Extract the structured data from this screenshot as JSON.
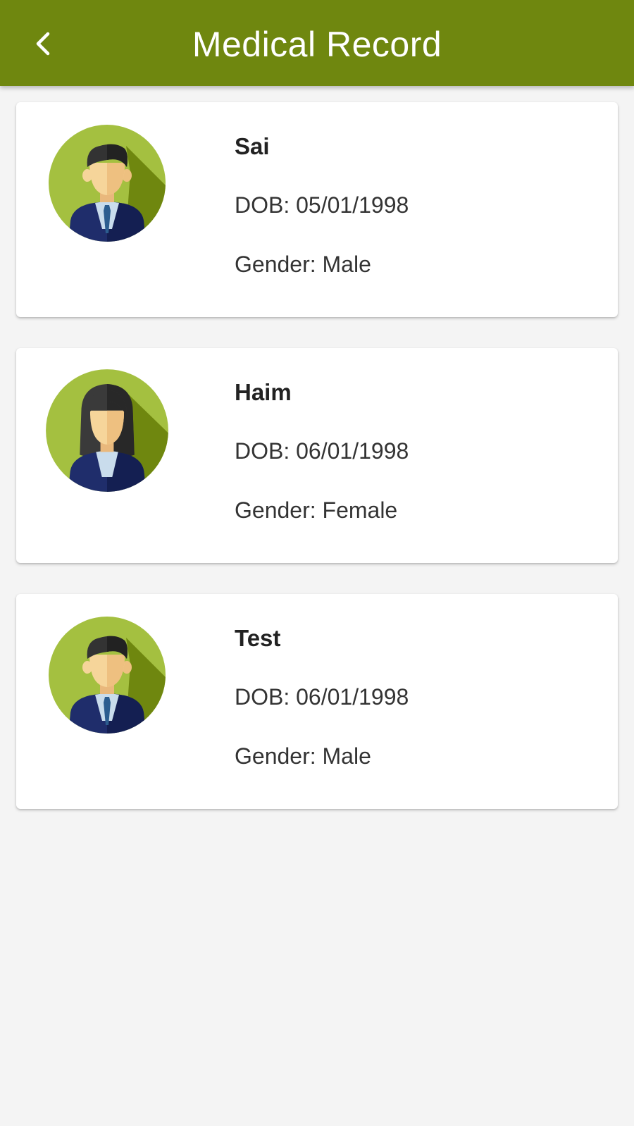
{
  "app_bar": {
    "title": "Medical Record",
    "back_icon": "chevron-left-icon",
    "color": "#6f870f"
  },
  "records": [
    {
      "name": "Sai",
      "dob": "DOB: 05/01/1998",
      "gender": "Gender: Male",
      "avatar": "male-avatar-icon"
    },
    {
      "name": "Haim",
      "dob": "DOB: 06/01/1998",
      "gender": "Gender: Female",
      "avatar": "female-avatar-icon"
    },
    {
      "name": "Test",
      "dob": "DOB: 06/01/1998",
      "gender": "Gender: Male",
      "avatar": "male-avatar-icon"
    }
  ],
  "colors": {
    "page_background": "#f4f4f4",
    "avatar_background": "#a4c040",
    "avatar_shadow": "#6f870f",
    "suit": "#1f2d6b"
  }
}
